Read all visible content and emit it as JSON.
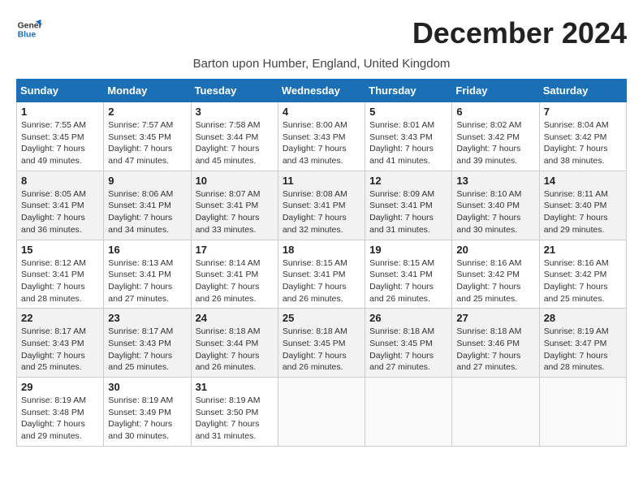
{
  "logo": {
    "line1": "General",
    "line2": "Blue"
  },
  "title": "December 2024",
  "subtitle": "Barton upon Humber, England, United Kingdom",
  "days_of_week": [
    "Sunday",
    "Monday",
    "Tuesday",
    "Wednesday",
    "Thursday",
    "Friday",
    "Saturday"
  ],
  "weeks": [
    [
      {
        "day": "1",
        "sunrise": "7:55 AM",
        "sunset": "3:45 PM",
        "daylight": "7 hours and 49 minutes."
      },
      {
        "day": "2",
        "sunrise": "7:57 AM",
        "sunset": "3:45 PM",
        "daylight": "7 hours and 47 minutes."
      },
      {
        "day": "3",
        "sunrise": "7:58 AM",
        "sunset": "3:44 PM",
        "daylight": "7 hours and 45 minutes."
      },
      {
        "day": "4",
        "sunrise": "8:00 AM",
        "sunset": "3:43 PM",
        "daylight": "7 hours and 43 minutes."
      },
      {
        "day": "5",
        "sunrise": "8:01 AM",
        "sunset": "3:43 PM",
        "daylight": "7 hours and 41 minutes."
      },
      {
        "day": "6",
        "sunrise": "8:02 AM",
        "sunset": "3:42 PM",
        "daylight": "7 hours and 39 minutes."
      },
      {
        "day": "7",
        "sunrise": "8:04 AM",
        "sunset": "3:42 PM",
        "daylight": "7 hours and 38 minutes."
      }
    ],
    [
      {
        "day": "8",
        "sunrise": "8:05 AM",
        "sunset": "3:41 PM",
        "daylight": "7 hours and 36 minutes."
      },
      {
        "day": "9",
        "sunrise": "8:06 AM",
        "sunset": "3:41 PM",
        "daylight": "7 hours and 34 minutes."
      },
      {
        "day": "10",
        "sunrise": "8:07 AM",
        "sunset": "3:41 PM",
        "daylight": "7 hours and 33 minutes."
      },
      {
        "day": "11",
        "sunrise": "8:08 AM",
        "sunset": "3:41 PM",
        "daylight": "7 hours and 32 minutes."
      },
      {
        "day": "12",
        "sunrise": "8:09 AM",
        "sunset": "3:41 PM",
        "daylight": "7 hours and 31 minutes."
      },
      {
        "day": "13",
        "sunrise": "8:10 AM",
        "sunset": "3:40 PM",
        "daylight": "7 hours and 30 minutes."
      },
      {
        "day": "14",
        "sunrise": "8:11 AM",
        "sunset": "3:40 PM",
        "daylight": "7 hours and 29 minutes."
      }
    ],
    [
      {
        "day": "15",
        "sunrise": "8:12 AM",
        "sunset": "3:41 PM",
        "daylight": "7 hours and 28 minutes."
      },
      {
        "day": "16",
        "sunrise": "8:13 AM",
        "sunset": "3:41 PM",
        "daylight": "7 hours and 27 minutes."
      },
      {
        "day": "17",
        "sunrise": "8:14 AM",
        "sunset": "3:41 PM",
        "daylight": "7 hours and 26 minutes."
      },
      {
        "day": "18",
        "sunrise": "8:15 AM",
        "sunset": "3:41 PM",
        "daylight": "7 hours and 26 minutes."
      },
      {
        "day": "19",
        "sunrise": "8:15 AM",
        "sunset": "3:41 PM",
        "daylight": "7 hours and 26 minutes."
      },
      {
        "day": "20",
        "sunrise": "8:16 AM",
        "sunset": "3:42 PM",
        "daylight": "7 hours and 25 minutes."
      },
      {
        "day": "21",
        "sunrise": "8:16 AM",
        "sunset": "3:42 PM",
        "daylight": "7 hours and 25 minutes."
      }
    ],
    [
      {
        "day": "22",
        "sunrise": "8:17 AM",
        "sunset": "3:43 PM",
        "daylight": "7 hours and 25 minutes."
      },
      {
        "day": "23",
        "sunrise": "8:17 AM",
        "sunset": "3:43 PM",
        "daylight": "7 hours and 25 minutes."
      },
      {
        "day": "24",
        "sunrise": "8:18 AM",
        "sunset": "3:44 PM",
        "daylight": "7 hours and 26 minutes."
      },
      {
        "day": "25",
        "sunrise": "8:18 AM",
        "sunset": "3:45 PM",
        "daylight": "7 hours and 26 minutes."
      },
      {
        "day": "26",
        "sunrise": "8:18 AM",
        "sunset": "3:45 PM",
        "daylight": "7 hours and 27 minutes."
      },
      {
        "day": "27",
        "sunrise": "8:18 AM",
        "sunset": "3:46 PM",
        "daylight": "7 hours and 27 minutes."
      },
      {
        "day": "28",
        "sunrise": "8:19 AM",
        "sunset": "3:47 PM",
        "daylight": "7 hours and 28 minutes."
      }
    ],
    [
      {
        "day": "29",
        "sunrise": "8:19 AM",
        "sunset": "3:48 PM",
        "daylight": "7 hours and 29 minutes."
      },
      {
        "day": "30",
        "sunrise": "8:19 AM",
        "sunset": "3:49 PM",
        "daylight": "7 hours and 30 minutes."
      },
      {
        "day": "31",
        "sunrise": "8:19 AM",
        "sunset": "3:50 PM",
        "daylight": "7 hours and 31 minutes."
      },
      null,
      null,
      null,
      null
    ]
  ]
}
